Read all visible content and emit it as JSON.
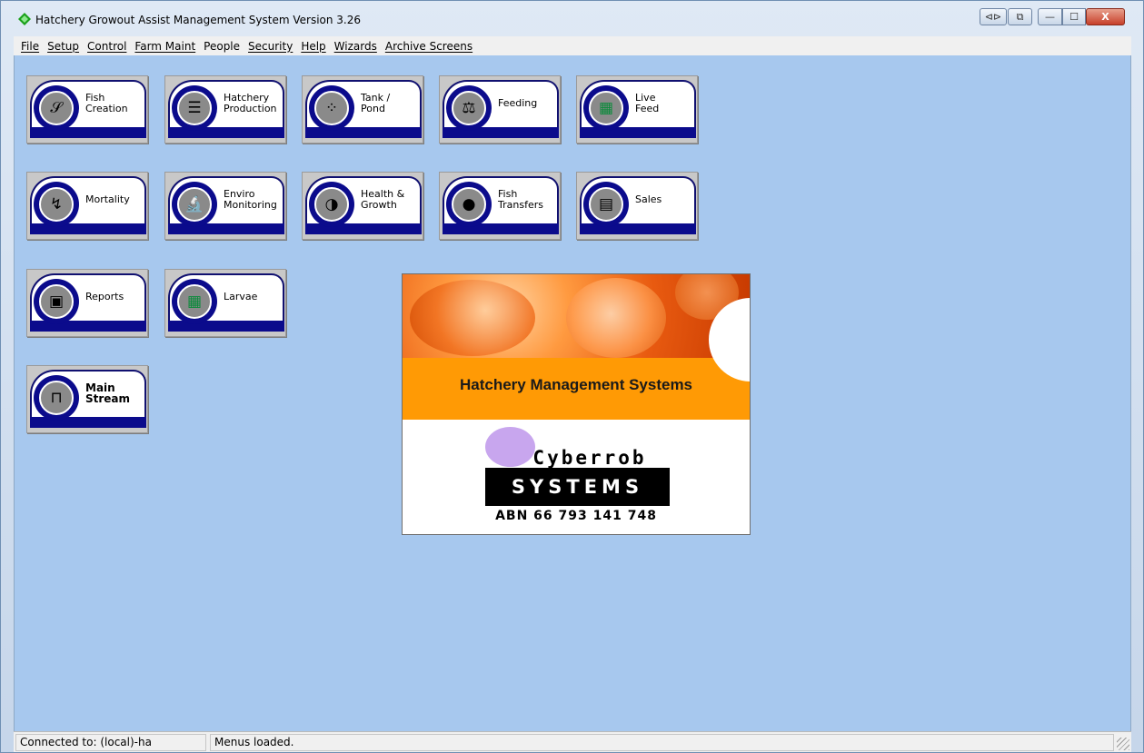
{
  "window": {
    "title": "Hatchery Growout Assist Management System Version 3.26",
    "controls": {
      "nav": "⊲⊳",
      "restore2": "⧉",
      "minimize": "—",
      "maximize": "☐",
      "close": "X"
    }
  },
  "menubar": {
    "items": [
      "File",
      "Setup",
      "Control",
      "Farm Maint",
      "People",
      "Security",
      "Help",
      "Wizards",
      "Archive Screens"
    ]
  },
  "modules": [
    {
      "line1": "Fish",
      "line2": "Creation",
      "icon": "sperm-icon",
      "glyph": "𝒮"
    },
    {
      "line1": "Hatchery",
      "line2": "Production",
      "icon": "hatchery-icon",
      "glyph": "☰"
    },
    {
      "line1": "Tank  /",
      "line2": "Pond",
      "icon": "tank-pond-icon",
      "glyph": "⁘"
    },
    {
      "line1": "Feeding",
      "line2": "",
      "icon": "scales-icon",
      "glyph": "⚖"
    },
    {
      "line1": "Live",
      "line2": "Feed",
      "icon": "live-feed-icon",
      "glyph": "▦"
    },
    {
      "line1": "Mortality",
      "line2": "",
      "icon": "mortality-icon",
      "glyph": "↯"
    },
    {
      "line1": "Enviro",
      "line2": "Monitoring",
      "icon": "microscope-icon",
      "glyph": "🔬"
    },
    {
      "line1": "Health &",
      "line2": "Growth",
      "icon": "fish-growth-icon",
      "glyph": "◑"
    },
    {
      "line1": "Fish",
      "line2": "Transfers",
      "icon": "bomb-icon",
      "glyph": "●"
    },
    {
      "line1": "Sales",
      "line2": "",
      "icon": "cash-register-icon",
      "glyph": "▤"
    },
    {
      "line1": "Reports",
      "line2": "",
      "icon": "reports-icon",
      "glyph": "▣"
    },
    {
      "line1": "Larvae",
      "line2": "",
      "icon": "larvae-icon",
      "glyph": "▦"
    },
    {
      "line1": "Main",
      "line2": "Stream",
      "icon": "main-stream-icon",
      "glyph": "⊓"
    }
  ],
  "splash": {
    "band_text": "Hatchery Management Systems",
    "brand": "Cyberrob",
    "systems": "SYSTEMS",
    "abn": "ABN 66 793 141 748"
  },
  "status": {
    "connection": "Connected to: (local)-ha",
    "message": "Menus loaded."
  },
  "colors": {
    "client_bg": "#a7c8ee",
    "module_navy": "#0b0b8c",
    "splash_orange": "#ff9a05"
  }
}
